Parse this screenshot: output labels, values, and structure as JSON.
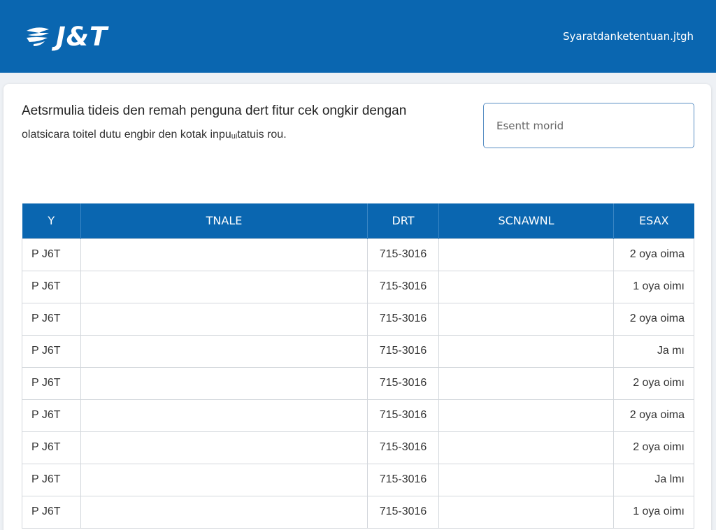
{
  "header": {
    "brand": "J&T",
    "link": "Syaratdanketentuan.jtgh"
  },
  "intro": {
    "line1": "Aetsrmulia tideis den remah penguna dert fitur cek ongkir dengan",
    "line2": "olatsicara toitel dutu engbir den kotak inpuᵤᵢtatuis rou."
  },
  "search": {
    "placeholder": "Esentt morid",
    "value": ""
  },
  "table": {
    "headers": [
      "Y",
      "TNALE",
      "DRT",
      "SCNAWNL",
      "ESAX"
    ],
    "rows": [
      {
        "resi": "P J6T",
        "tnale": "",
        "date": "715-3016",
        "scnawnl": "",
        "est": "2 oya oima"
      },
      {
        "resi": "P J6T",
        "tnale": "",
        "date": "715-3016",
        "scnawnl": "",
        "est": "1 oya oimı"
      },
      {
        "resi": "P J6T",
        "tnale": "",
        "date": "715-3016",
        "scnawnl": "",
        "est": "2 oya oima"
      },
      {
        "resi": "P J6T",
        "tnale": "",
        "date": "715-3016",
        "scnawnl": "",
        "est": "Ja mı"
      },
      {
        "resi": "P J6T",
        "tnale": "",
        "date": "715-3016",
        "scnawnl": "",
        "est": "2 oya oimı"
      },
      {
        "resi": "P J6T",
        "tnale": "",
        "date": "715-3016",
        "scnawnl": "",
        "est": "2 oya oima"
      },
      {
        "resi": "P J6T",
        "tnale": "",
        "date": "715-3016",
        "scnawnl": "",
        "est": "2 oya oimı"
      },
      {
        "resi": "P J6T",
        "tnale": "",
        "date": "715-3016",
        "scnawnl": "",
        "est": "Ja lmı"
      },
      {
        "resi": "P J6T",
        "tnale": "",
        "date": "715-3016",
        "scnawnl": "",
        "est": "1 oya oimı"
      }
    ]
  },
  "colors": {
    "brand_blue": "#0a66b0",
    "border": "#d3d7dc",
    "input_border": "#5a8fc4"
  },
  "icons": {
    "logo": "jt-swoosh-logo-icon"
  }
}
